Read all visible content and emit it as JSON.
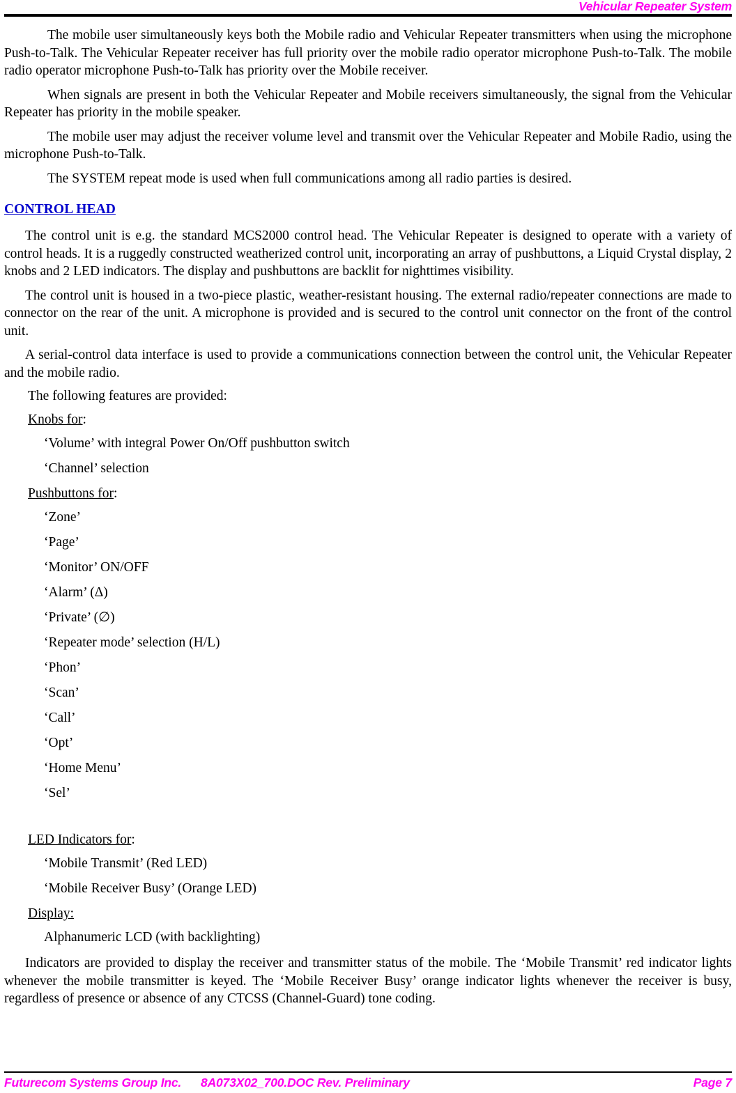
{
  "header": {
    "title": "Vehicular Repeater System"
  },
  "body": {
    "paragraphs": [
      "The mobile user simultaneously keys both the Mobile radio and Vehicular Repeater transmitters when using the microphone Push-to-Talk. The Vehicular Repeater receiver has full priority over the mobile radio operator microphone Push-to-Talk. The mobile radio operator microphone Push-to-Talk has priority over the Mobile receiver.",
      "When signals are present in both the Vehicular Repeater and Mobile receivers simultaneously, the signal from the Vehicular Repeater has priority in the mobile speaker.",
      "The mobile user may adjust the receiver volume level and transmit over the Vehicular Repeater and Mobile Radio, using the microphone Push-to-Talk.",
      "The SYSTEM repeat mode is used when full communications among all radio parties is desired."
    ]
  },
  "section": {
    "heading": "CONTROL HEAD",
    "paragraphs": [
      "The control unit is e.g. the standard MCS2000 control head. The Vehicular Repeater is designed to operate with a variety of control heads. It is a ruggedly constructed weatherized control unit, incorporating an array of pushbuttons, a Liquid Crystal display, 2 knobs and 2 LED indicators. The display and pushbuttons are backlit for nighttimes visibility.",
      "The control unit is housed in a two-piece plastic, weather-resistant housing. The external radio/repeater connections are made to connector on the rear of the unit. A microphone is provided and is secured to the control unit connector on the front of the control unit.",
      "A serial-control data interface is used to provide a communications connection between the control unit, the Vehicular Repeater and the mobile radio."
    ],
    "features_intro": "The following features are provided:",
    "groups": [
      {
        "label_underlined": "Knobs for",
        "label_suffix": ":",
        "items": [
          "‘Volume’ with integral Power On/Off pushbutton switch",
          "‘Channel’ selection"
        ]
      },
      {
        "label_underlined": "Pushbuttons for",
        "label_suffix": ":",
        "items": [
          "‘Zone’",
          "‘Page’",
          "‘Monitor’ ON/OFF",
          "‘Alarm’ (Δ)",
          "‘Private’ (∅)",
          "‘Repeater mode’ selection (H/L)",
          "‘Phon’",
          "‘Scan’",
          "‘Call’",
          "‘Opt’",
          "‘Home Menu’",
          "‘Sel’"
        ]
      },
      {
        "label_underlined": "LED Indicators for",
        "label_suffix": ":",
        "items": [
          "‘Mobile Transmit’ (Red LED)",
          "‘Mobile Receiver Busy’ (Orange LED)"
        ]
      },
      {
        "label_underlined": "Display:",
        "label_suffix": "",
        "items": [
          "Alphanumeric LCD (with backlighting)"
        ]
      }
    ],
    "closing_paragraph": "Indicators are provided to display the receiver and transmitter status of the mobile. The ‘Mobile Transmit’ red indicator lights whenever the mobile transmitter is keyed. The ‘Mobile Receiver Busy’ orange indicator lights whenever the receiver is busy, regardless of presence or absence of any CTCSS (Channel-Guard) tone coding."
  },
  "footer": {
    "company": "Futurecom Systems Group Inc.",
    "document": "8A073X02_700.DOC Rev. Preliminary",
    "page": "Page 7"
  },
  "colors": {
    "accent_magenta": "#FF00F0",
    "heading_blue": "#0000CC",
    "rule_black": "#000000"
  }
}
